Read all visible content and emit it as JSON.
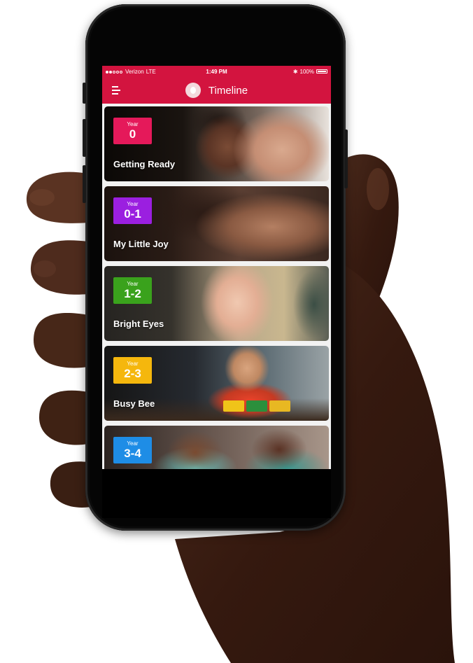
{
  "status_bar": {
    "carrier": "Verizon",
    "network": "LTE",
    "time": "1:49 PM",
    "battery": "100%",
    "signal_full": 2,
    "signal_total": 5
  },
  "nav": {
    "title": "Timeline",
    "menu_icon": "hamburger-menu-icon",
    "logo_icon": "app-logo-icon"
  },
  "colors": {
    "brand": "#d3143f",
    "year_0": "#e5195a",
    "year_0_1": "#9b1fe0",
    "year_1_2": "#3aa21c",
    "year_2_3": "#f5b70d",
    "year_3_4": "#1e8de6"
  },
  "cards": [
    {
      "year_label": "Year",
      "range": "0",
      "title": "Getting Ready"
    },
    {
      "year_label": "Year",
      "range": "0-1",
      "title": "My Little Joy"
    },
    {
      "year_label": "Year",
      "range": "1-2",
      "title": "Bright Eyes"
    },
    {
      "year_label": "Year",
      "range": "2-3",
      "title": "Busy Bee"
    },
    {
      "year_label": "Year",
      "range": "3-4",
      "title": ""
    }
  ]
}
